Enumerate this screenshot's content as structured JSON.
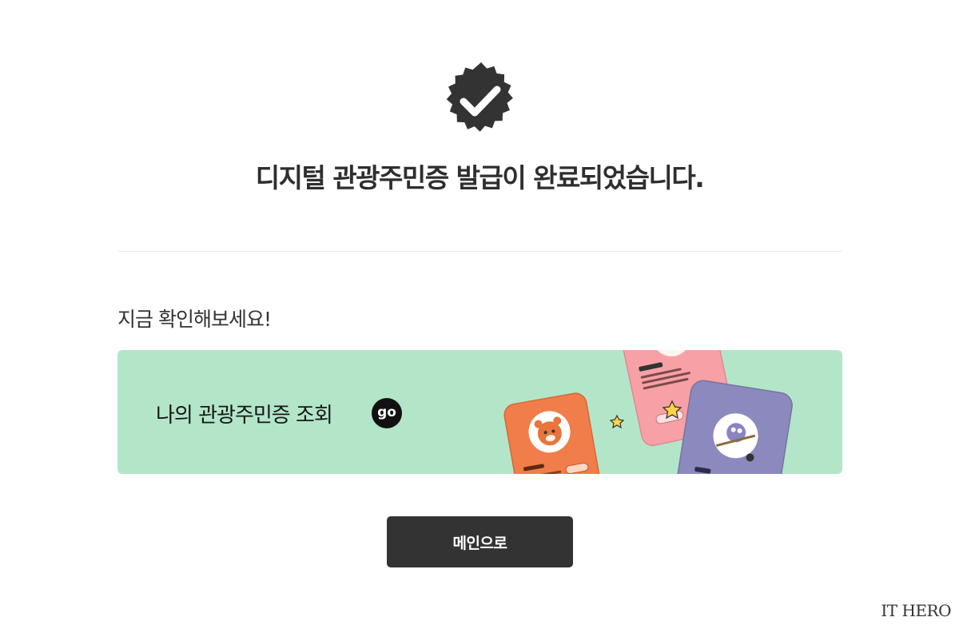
{
  "header": {
    "icon": "check-badge-icon",
    "title": "디지털 관광주민증 발급이 완료되었습니다."
  },
  "section": {
    "heading": "지금 확인해보세요!"
  },
  "banner": {
    "label": "나의 관광주민증 조회",
    "go_label": "go",
    "background": "#b3e6c8"
  },
  "actions": {
    "main_label": "메인으로"
  },
  "watermark": {
    "text": "IT HERO"
  },
  "colors": {
    "dark": "#333333",
    "card_pink": "#f7a1a6",
    "card_orange": "#f07d4a",
    "card_purple": "#8c89bf"
  }
}
